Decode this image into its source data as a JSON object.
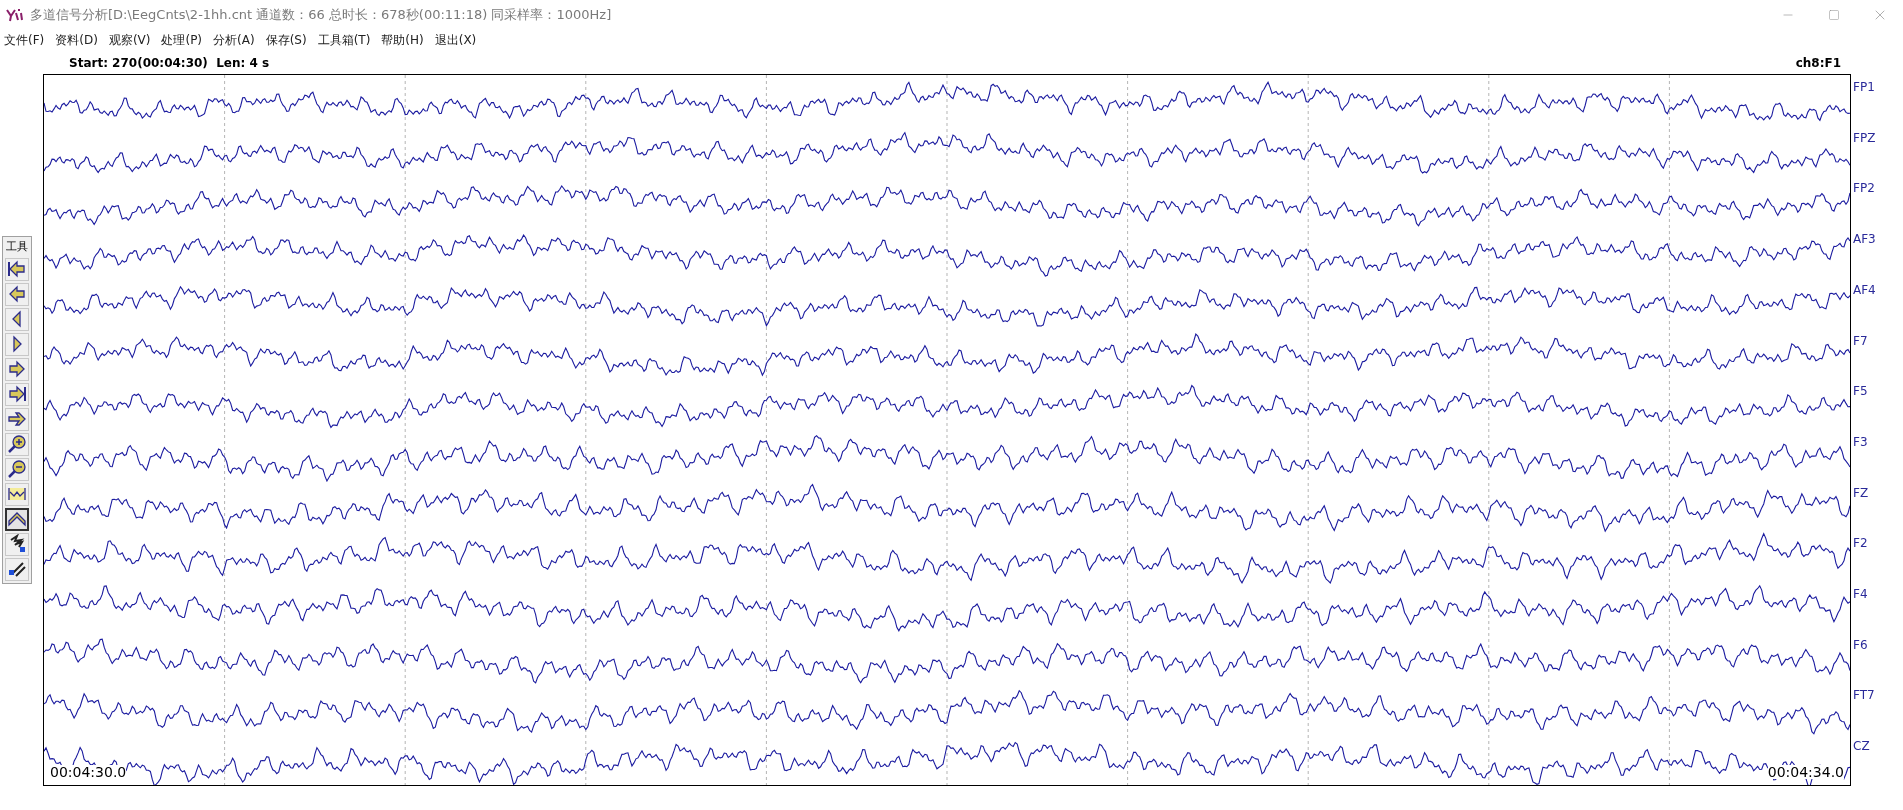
{
  "window": {
    "title": "多道信号分析[D:\\EegCnts\\2-1hh.cnt 通道数：66  总时长：678秒(00:11:18)  同采样率：1000Hz]"
  },
  "menu": [
    "文件(F)",
    "资料(D)",
    "观察(V)",
    "处理(P)",
    "分析(A)",
    "保存(S)",
    "工具箱(T)",
    "帮助(H)",
    "退出(X)"
  ],
  "info": {
    "range": "Start: 270(00:04:30)  Len: 4 s",
    "cursor_channel": "ch8:F1"
  },
  "toolbar": {
    "title": "工具",
    "buttons": [
      {
        "kind": "first",
        "selected": false
      },
      {
        "kind": "prev",
        "selected": false
      },
      {
        "kind": "step-back",
        "selected": false
      },
      {
        "kind": "step-forward",
        "selected": false
      },
      {
        "kind": "next",
        "selected": false
      },
      {
        "kind": "last",
        "selected": false
      },
      {
        "kind": "forward",
        "selected": false
      },
      {
        "kind": "zoom-in",
        "selected": false
      },
      {
        "kind": "zoom-out",
        "selected": false
      },
      {
        "kind": "fit",
        "selected": false
      },
      {
        "kind": "expand",
        "selected": true
      },
      {
        "kind": "link",
        "selected": false
      },
      {
        "kind": "unlink",
        "selected": false
      }
    ]
  },
  "channels": [
    "FP1",
    "FPZ",
    "FP2",
    "AF3",
    "AF4",
    "F7",
    "F5",
    "F3",
    "FZ",
    "F2",
    "F4",
    "F6",
    "FT7",
    "CZ"
  ],
  "time_start": "00:04:30.0",
  "time_end": "00:04:34.0"
}
